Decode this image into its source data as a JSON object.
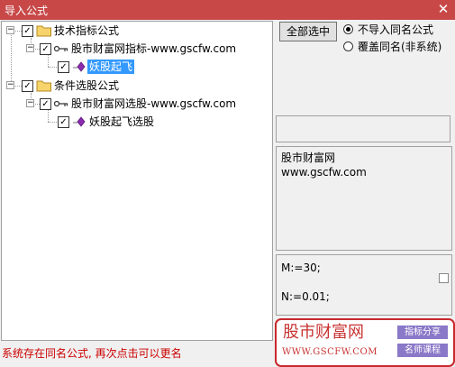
{
  "window": {
    "title": "导入公式",
    "close_glyph": "✕"
  },
  "tree": {
    "expand_glyph": "−",
    "check_glyph": "✓",
    "nodes": [
      {
        "label": "技术指标公式",
        "icon": "folder-icon"
      },
      {
        "label": "股市财富网指标-www.gscfw.com",
        "icon": "key-icon"
      },
      {
        "label": "妖股起飞",
        "icon": "formula-icon",
        "selected": true
      },
      {
        "label": "条件选股公式",
        "icon": "folder-icon"
      },
      {
        "label": "股市财富网选股-www.gscfw.com",
        "icon": "key-icon"
      },
      {
        "label": "妖股起飞选股",
        "icon": "formula-icon"
      }
    ]
  },
  "options": {
    "select_all_label": "全部选中",
    "radio_no_import": "不导入同名公式",
    "radio_overwrite": "覆盖同名(非系统)",
    "selected_radio": "不导入同名公式"
  },
  "info": {
    "line1": "股市财富网",
    "line2": "www.gscfw.com"
  },
  "code": {
    "line1": "M:=30;",
    "line2": "N:=0.01;"
  },
  "status": "系统存在同名公式, 再次点击可以更名",
  "watermark": {
    "main": "股市财富网",
    "url": "WWW.GSCFW.COM",
    "tag1": "指标分享",
    "tag2": "名师课程"
  },
  "colors": {
    "titlebar": "#c84848",
    "selection": "#3399ff",
    "status_text": "#cc0000",
    "watermark_red": "#c8282d",
    "watermark_tag": "#8a78c8"
  }
}
